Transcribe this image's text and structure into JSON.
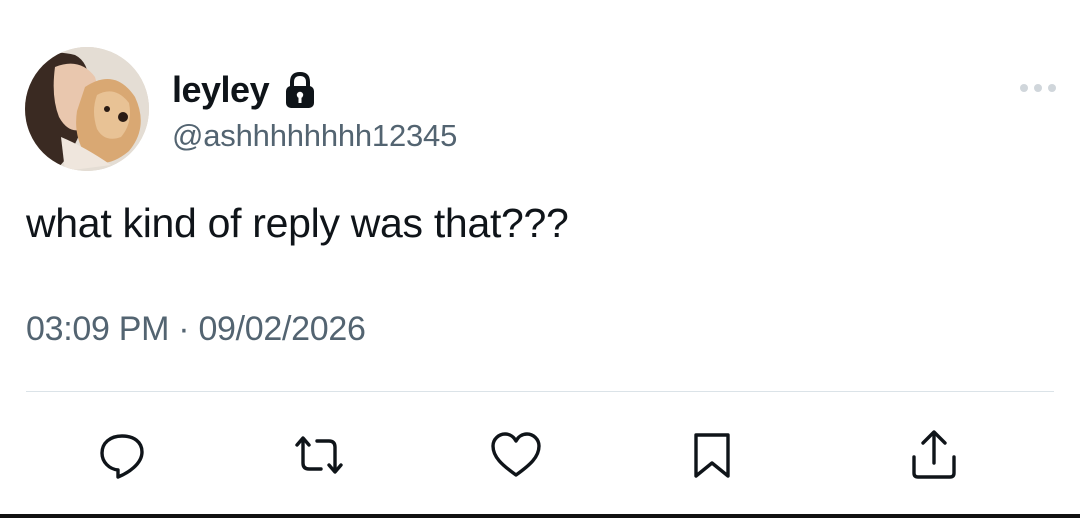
{
  "user": {
    "display_name": "leyley",
    "handle": "@ashhhhhhhh12345",
    "protected_icon": "lock-icon",
    "avatar_alt": "profile photo"
  },
  "tweet": {
    "text": "what kind of reply was that???",
    "timestamp": "03:09 PM · 09/02/2026"
  },
  "actions": [
    {
      "name": "reply",
      "icon": "speech-bubble-icon"
    },
    {
      "name": "retweet",
      "icon": "retweet-icon"
    },
    {
      "name": "like",
      "icon": "heart-icon"
    },
    {
      "name": "bookmark",
      "icon": "bookmark-icon"
    },
    {
      "name": "share",
      "icon": "share-icon"
    }
  ],
  "colors": {
    "text_primary": "#0f1419",
    "text_secondary": "#536471",
    "divider": "#dbe3e8"
  }
}
